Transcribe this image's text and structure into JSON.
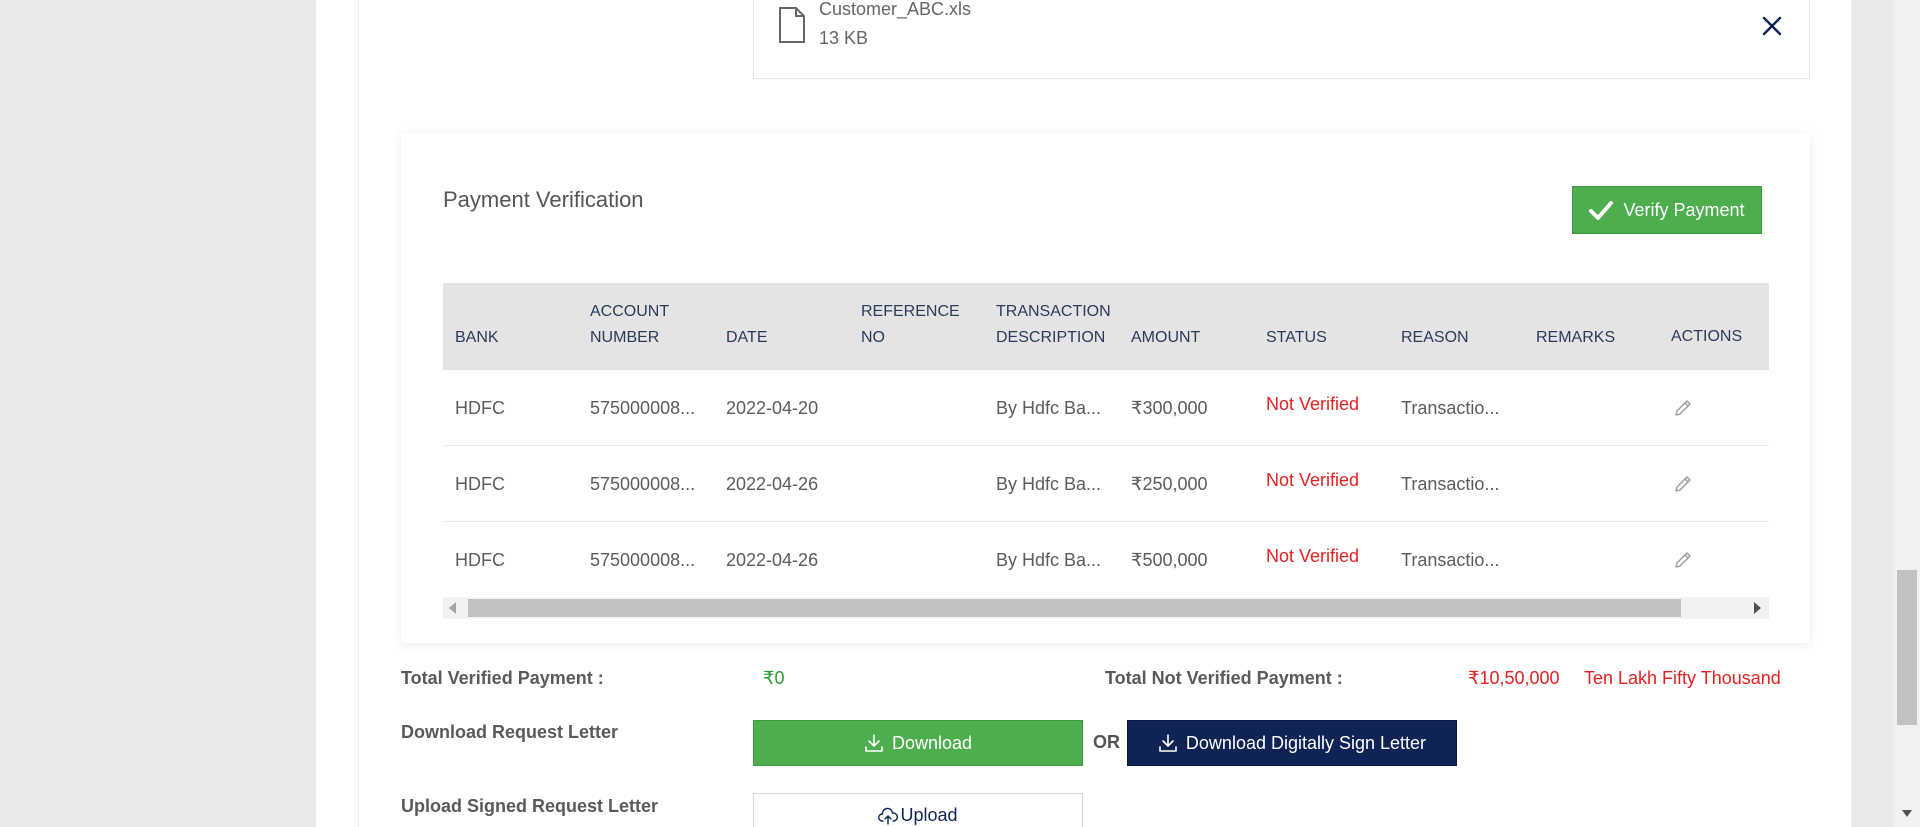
{
  "file": {
    "name": "Customer_ABC.xls",
    "size": "13 KB"
  },
  "payment_verification": {
    "title": "Payment Verification",
    "verify_button": "Verify Payment",
    "columns": {
      "bank": "BANK",
      "account_number_1": "ACCOUNT",
      "account_number_2": "NUMBER",
      "date": "DATE",
      "reference_no_1": "REFERENCE",
      "reference_no_2": "NO",
      "transaction_description_1": "TRANSACTION",
      "transaction_description_2": "DESCRIPTION",
      "amount": "AMOUNT",
      "status": "STATUS",
      "reason": "REASON",
      "remarks": "REMARKS",
      "actions": "ACTIONS"
    },
    "rows": [
      {
        "bank": "HDFC",
        "account": "575000008...",
        "date": "2022-04-20",
        "reference": "",
        "description": "By Hdfc Ba...",
        "amount": "₹300,000",
        "status": "Not Verified",
        "reason": "Transactio...",
        "remarks": ""
      },
      {
        "bank": "HDFC",
        "account": "575000008...",
        "date": "2022-04-26",
        "reference": "",
        "description": "By Hdfc Ba...",
        "amount": "₹250,000",
        "status": "Not Verified",
        "reason": "Transactio...",
        "remarks": ""
      },
      {
        "bank": "HDFC",
        "account": "575000008...",
        "date": "2022-04-26",
        "reference": "",
        "description": "By Hdfc Ba...",
        "amount": "₹500,000",
        "status": "Not Verified",
        "reason": "Transactio...",
        "remarks": ""
      }
    ]
  },
  "totals": {
    "verified_label": "Total Verified Payment :",
    "verified_value": "₹0",
    "not_verified_label": "Total Not Verified Payment :",
    "not_verified_value": "₹10,50,000",
    "not_verified_words": "Ten Lakh Fifty Thousand"
  },
  "request_letter": {
    "download_label": "Download Request Letter",
    "download_button": "Download",
    "or_text": "OR",
    "digital_sign_button": "Download Digitally Sign Letter",
    "upload_label": "Upload Signed Request Letter",
    "upload_button": "Upload"
  },
  "colors": {
    "green": "#4cae4c",
    "navy": "#0f2454",
    "red": "#e32222"
  },
  "icons": {
    "file": "file-icon",
    "close": "close-icon",
    "check": "check-icon",
    "edit": "pencil-icon",
    "download": "download-icon",
    "upload": "cloud-upload-icon"
  }
}
